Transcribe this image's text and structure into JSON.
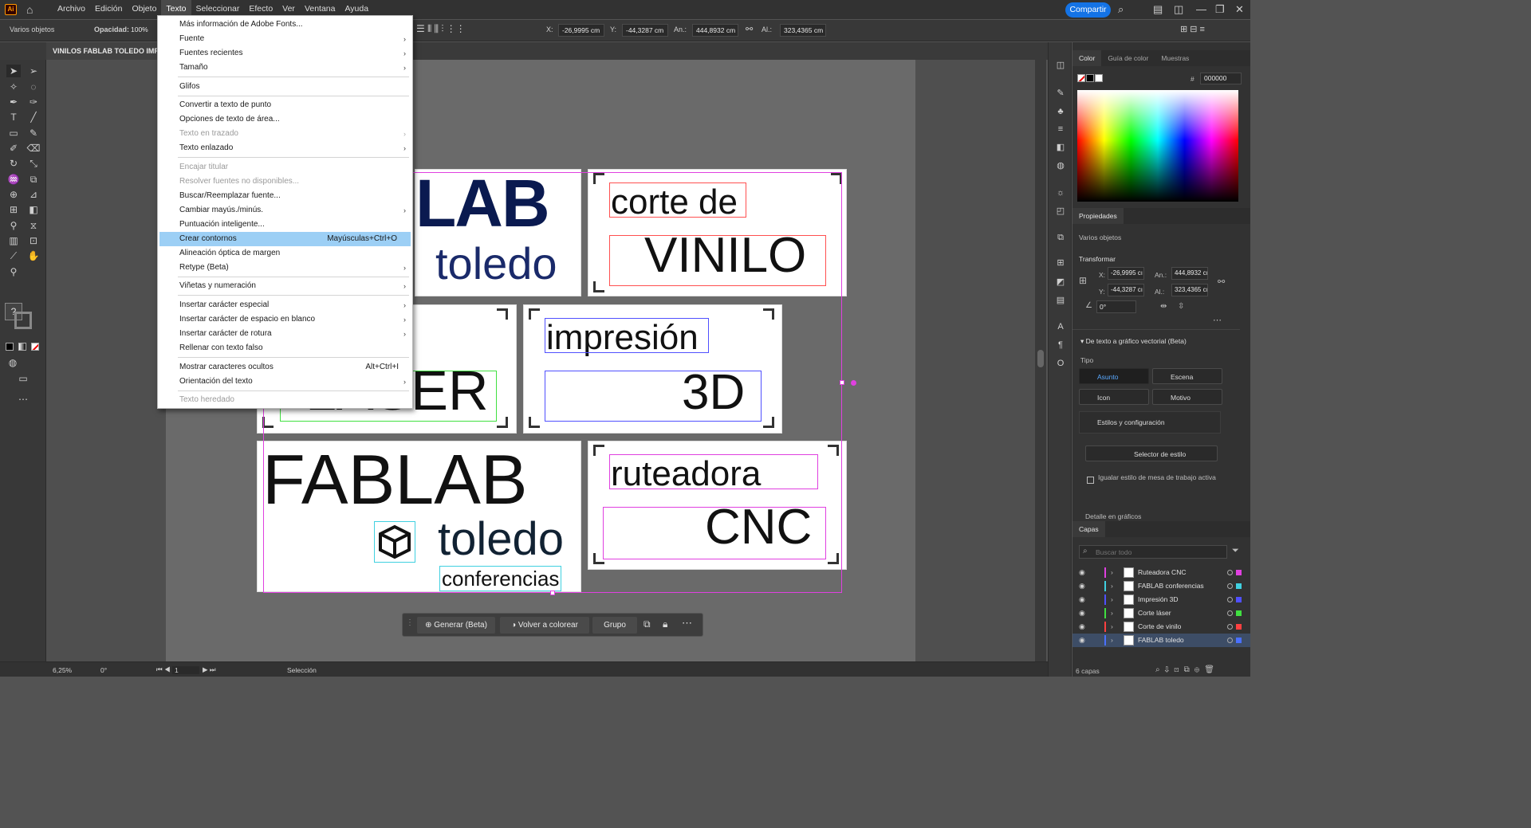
{
  "app": {
    "logo": "Ai"
  },
  "menubar": {
    "items": [
      "Archivo",
      "Edición",
      "Objeto",
      "Texto",
      "Seleccionar",
      "Efecto",
      "Ver",
      "Ventana",
      "Ayuda"
    ],
    "active_index": 3,
    "share_label": "Compartir"
  },
  "controlbar": {
    "selection_label": "Varios objetos",
    "opacity_label": "Opacidad:",
    "opacity_value": "100%",
    "x_label": "X:",
    "x_value": "-26,9995 cm",
    "y_label": "Y:",
    "y_value": "-44,3287 cm",
    "w_label": "An.:",
    "w_value": "444,8932 cm",
    "h_label": "Al.:",
    "h_value": "323,4365 cm"
  },
  "document_tab": {
    "title": "VINILOS FABLAB TOLEDO IMP"
  },
  "text_menu": {
    "items": [
      {
        "label": "Más información de Adobe Fonts...",
        "disabled": false
      },
      {
        "label": "Fuente",
        "submenu": true
      },
      {
        "label": "Fuentes recientes",
        "submenu": true
      },
      {
        "label": "Tamaño",
        "submenu": true
      },
      {
        "label": "Glifos"
      },
      {
        "label": "Convertir a texto de punto"
      },
      {
        "label": "Opciones de texto de área..."
      },
      {
        "label": "Texto en trazado",
        "submenu": true,
        "disabled": true
      },
      {
        "label": "Texto enlazado",
        "submenu": true
      },
      {
        "label": "Encajar titular",
        "disabled": true
      },
      {
        "label": "Resolver fuentes no disponibles...",
        "disabled": true
      },
      {
        "label": "Buscar/Reemplazar fuente..."
      },
      {
        "label": "Cambiar mayús./minús.",
        "submenu": true
      },
      {
        "label": "Puntuación inteligente..."
      },
      {
        "label": "Crear contornos",
        "shortcut": "Mayúsculas+Ctrl+O",
        "highlighted": true
      },
      {
        "label": "Alineación óptica de margen"
      },
      {
        "label": "Retype (Beta)",
        "submenu": true
      },
      {
        "label": "Viñetas y numeración",
        "submenu": true
      },
      {
        "label": "Insertar carácter especial",
        "submenu": true
      },
      {
        "label": "Insertar carácter de espacio en blanco",
        "submenu": true
      },
      {
        "label": "Insertar carácter de rotura",
        "submenu": true
      },
      {
        "label": "Rellenar con texto falso"
      },
      {
        "label": "Mostrar caracteres ocultos",
        "shortcut": "Alt+Ctrl+I"
      },
      {
        "label": "Orientación del texto",
        "submenu": true
      },
      {
        "label": "Texto heredado",
        "disabled": true
      }
    ]
  },
  "canvas": {
    "card1": {
      "big": "LAB",
      "small": "toledo"
    },
    "card2": {
      "line1": "corte de",
      "line2": "VINILO"
    },
    "card3": {
      "big": "LÁSER"
    },
    "card4": {
      "line1": "impresión",
      "line2": "3D"
    },
    "card5": {
      "big": "FABLAB",
      "small": "toledo",
      "sub": "conferencias"
    },
    "card6": {
      "line1": "ruteadora",
      "line2": "CNC"
    }
  },
  "contextbar": {
    "generate_label": "Generar (Beta)",
    "recolor_label": "Volver a colorear",
    "group_label": "Grupo"
  },
  "statusbar": {
    "zoom": "6,25%",
    "rotation": "0°",
    "artboard": "1",
    "tool": "Selección"
  },
  "color_panel": {
    "tabs": [
      "Color",
      "Guía de color",
      "Muestras"
    ],
    "hex_label": "#",
    "hex_value": "000000"
  },
  "properties_panel": {
    "title": "Propiedades",
    "selection": "Varios objetos",
    "transform_label": "Transformar",
    "x_label": "X:",
    "x_value": "-26,9995 cı",
    "y_label": "Y:",
    "y_value": "-44,3287 cı",
    "w_label": "An.:",
    "w_value": "444,8932 cı",
    "h_label": "Al.:",
    "h_value": "323,4365 cı",
    "angle_value": "0°",
    "text_to_vector_label": "De texto a gráfico vectorial (Beta)",
    "type_label": "Tipo",
    "type_options": [
      "Asunto",
      "Escena",
      "Icon",
      "Motivo"
    ],
    "styles_label": "Estilos y configuración",
    "style_selector_label": "Selector de estilo",
    "match_label": "Igualar estilo de mesa de trabajo activa",
    "detail_label": "Detalle en gráficos"
  },
  "layers_panel": {
    "title": "Capas",
    "search_placeholder": "Buscar todo",
    "layers": [
      {
        "name": "Ruteadora CNC",
        "color": "#e040e0"
      },
      {
        "name": "FABLAB conferencias",
        "color": "#40d0e0"
      },
      {
        "name": "Impresión 3D",
        "color": "#5050ff"
      },
      {
        "name": "Corte láser",
        "color": "#40e040"
      },
      {
        "name": "Corte de vinilo",
        "color": "#ff4040"
      },
      {
        "name": "FABLAB toledo",
        "color": "#4a70ff"
      }
    ],
    "count_label": "6 capas"
  },
  "colors": {
    "accent": "#1473e6",
    "menu_highlight": "#9ccff5",
    "selection_magenta": "#e040e0"
  }
}
